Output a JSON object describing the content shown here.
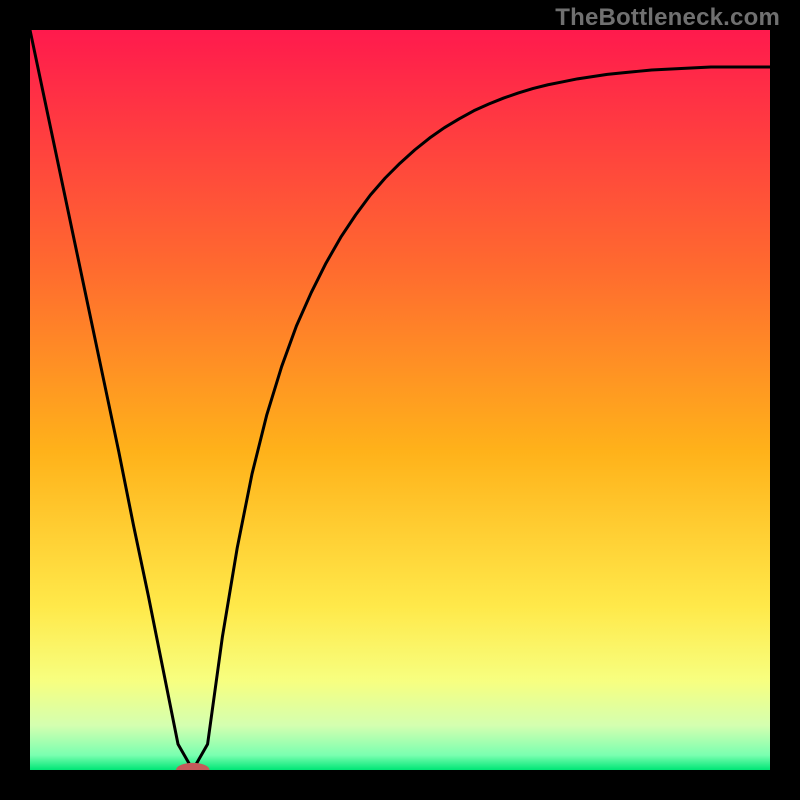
{
  "watermark": "TheBottleneck.com",
  "colors": {
    "frame": "#000000",
    "gradient_stops": [
      {
        "offset": 0.0,
        "color": "#ff1a4d"
      },
      {
        "offset": 0.32,
        "color": "#ff6a2f"
      },
      {
        "offset": 0.57,
        "color": "#ffb21a"
      },
      {
        "offset": 0.78,
        "color": "#ffe94a"
      },
      {
        "offset": 0.88,
        "color": "#f7ff80"
      },
      {
        "offset": 0.94,
        "color": "#d4ffb0"
      },
      {
        "offset": 0.98,
        "color": "#7affb0"
      },
      {
        "offset": 1.0,
        "color": "#00e676"
      }
    ],
    "curve": "#000000",
    "marker_fill": "#c45a5a",
    "marker_stroke": "#c45a5a"
  },
  "chart_data": {
    "type": "line",
    "title": "",
    "xlabel": "",
    "ylabel": "",
    "xlim": [
      0,
      100
    ],
    "ylim": [
      0,
      100
    ],
    "x": [
      0,
      2,
      4,
      6,
      8,
      10,
      12,
      14,
      16,
      18,
      20,
      22,
      24,
      26,
      28,
      30,
      32,
      34,
      36,
      38,
      40,
      42,
      44,
      46,
      48,
      50,
      52,
      54,
      56,
      58,
      60,
      62,
      64,
      66,
      68,
      70,
      72,
      74,
      76,
      78,
      80,
      82,
      84,
      86,
      88,
      90,
      92,
      94,
      96,
      98,
      100
    ],
    "series": [
      {
        "name": "bottleneck-curve",
        "values": [
          100,
          90.5,
          81,
          71.5,
          62,
          52.5,
          43,
          33,
          23.5,
          13.5,
          3.5,
          0,
          3.5,
          18,
          30,
          40,
          48,
          54.5,
          60,
          64.5,
          68.5,
          72,
          75,
          77.7,
          80,
          82,
          83.8,
          85.4,
          86.8,
          88,
          89.1,
          90,
          90.8,
          91.5,
          92.1,
          92.6,
          93,
          93.4,
          93.7,
          94,
          94.2,
          94.4,
          94.6,
          94.7,
          94.8,
          94.9,
          95,
          95,
          95,
          95,
          95
        ]
      }
    ],
    "marker": {
      "x": 22,
      "y": 0,
      "rx": 2.2,
      "ry": 0.9
    }
  }
}
